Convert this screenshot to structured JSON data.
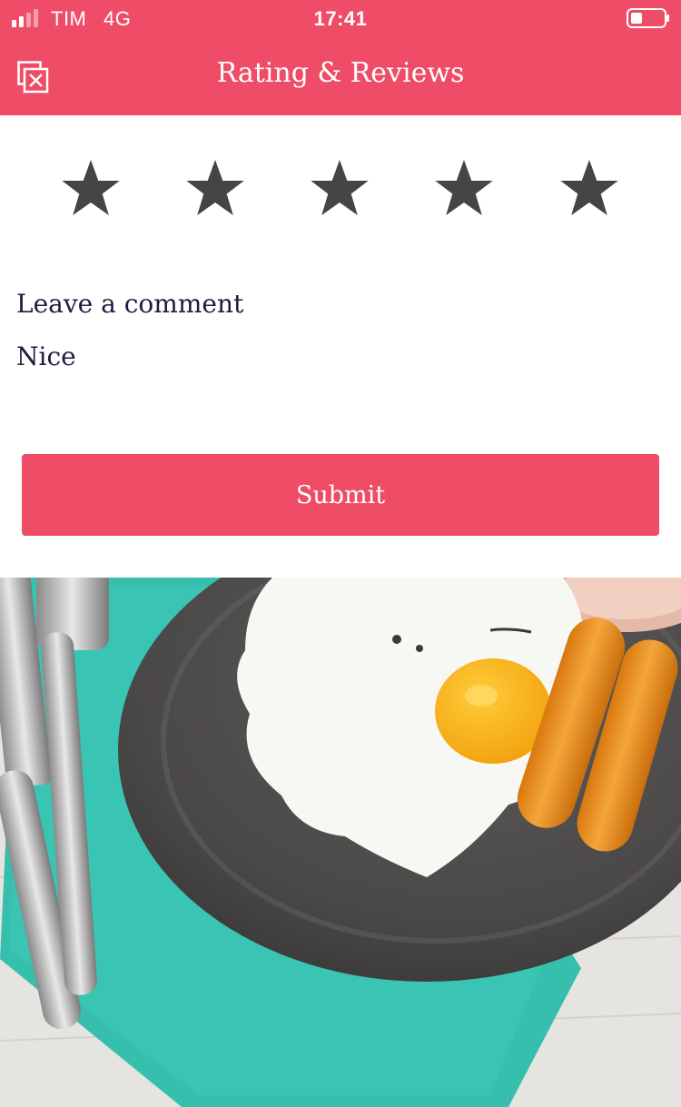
{
  "status_bar": {
    "carrier": "TIM",
    "network": "4G",
    "time": "17:41"
  },
  "header": {
    "title": "Rating & Reviews",
    "close_icon": "close-window-icon"
  },
  "rating": {
    "value": 5,
    "max": 5,
    "star_icon": "star-icon",
    "star_color": "#454545"
  },
  "comment": {
    "label": "Leave a comment",
    "value": "Nice"
  },
  "submit": {
    "label": "Submit"
  },
  "colors": {
    "accent": "#ef4d67",
    "text": "#1d1d3f"
  }
}
